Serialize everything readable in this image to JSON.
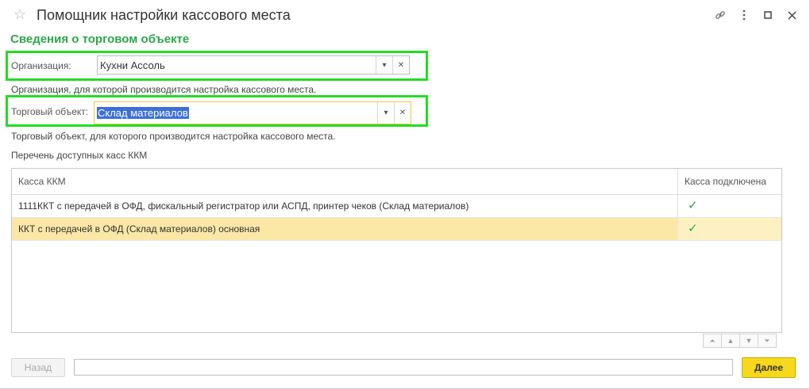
{
  "window": {
    "title": "Помощник настройки кассового места",
    "icons": [
      "star-icon",
      "link-icon",
      "more-icon",
      "maximize-icon",
      "close-icon"
    ]
  },
  "section": {
    "title": "Сведения о торговом объекте"
  },
  "organization": {
    "label": "Организация:",
    "value": "Кухни Ассоль",
    "hint": "Организация, для которой производится настройка кассового места."
  },
  "trade_object": {
    "label": "Торговый объект:",
    "value": "Склад материалов",
    "hint": "Торговый объект, для которого производится настройка кассового места."
  },
  "list": {
    "caption": "Перечень доступных касс ККМ",
    "columns": [
      "Касса ККМ",
      "Касса подключена"
    ],
    "rows": [
      {
        "name": "1111ККТ с передачей в ОФД, фискальный регистратор или АСПД, принтер чеков (Склад материалов)",
        "connected": "✓"
      },
      {
        "name": "ККТ с передачей в ОФД (Склад материалов) основная",
        "connected": "✓"
      }
    ]
  },
  "footer": {
    "back_label": "Назад",
    "next_label": "Далее"
  },
  "colors": {
    "accent_green": "#2aa64a",
    "highlight_frame": "#22dd22",
    "selected_row": "#fbe8a6",
    "primary_button": "#f8d81c"
  }
}
